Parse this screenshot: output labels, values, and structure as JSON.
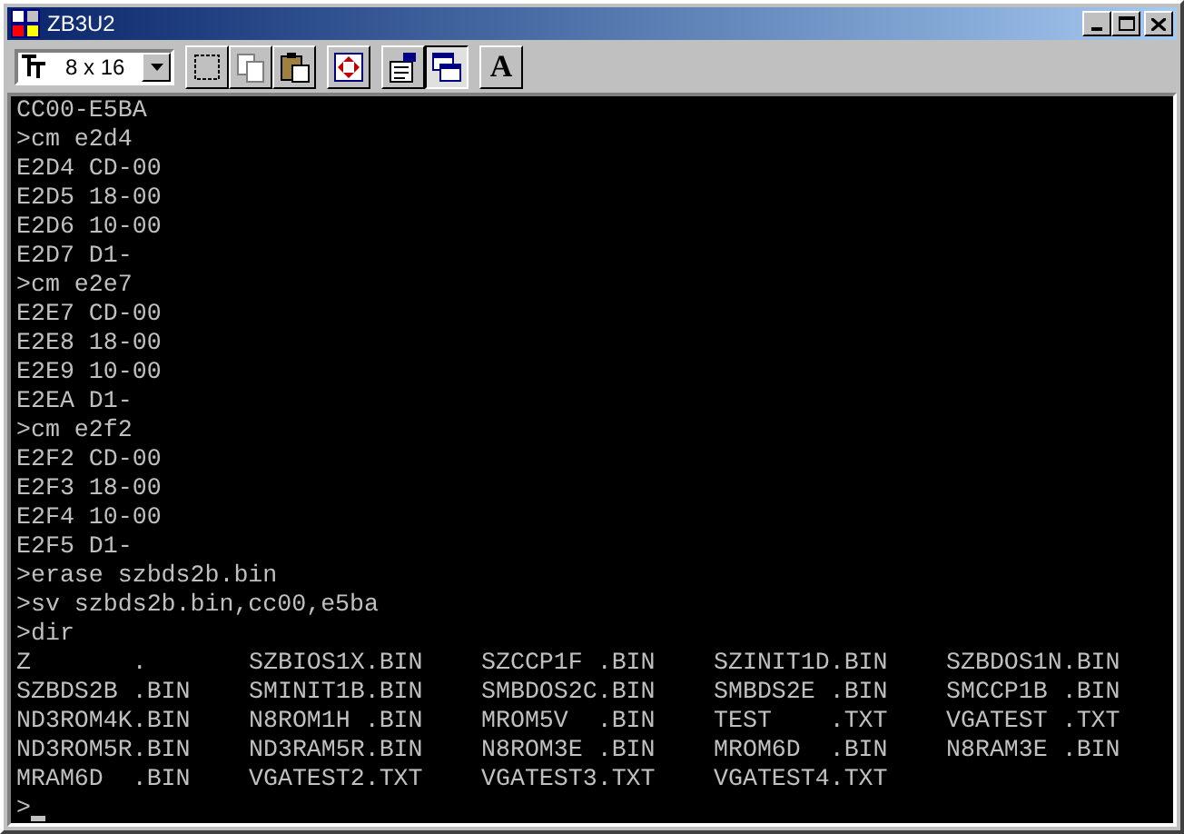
{
  "window": {
    "title": "ZB3U2"
  },
  "toolbar": {
    "font_size": "8 x 16",
    "buttons": [
      {
        "kind": "mark",
        "pressed": false
      },
      {
        "kind": "copy",
        "pressed": false
      },
      {
        "kind": "paste",
        "pressed": false
      },
      {
        "kind": "fullscreen",
        "pressed": false
      },
      {
        "kind": "properties",
        "pressed": false
      },
      {
        "kind": "background",
        "pressed": true
      },
      {
        "kind": "font",
        "pressed": false,
        "label": "A"
      }
    ]
  },
  "console": {
    "lines": [
      {
        "kind": "text",
        "text": "CC00-E5BA"
      },
      {
        "kind": "text",
        "text": ">cm e2d4"
      },
      {
        "kind": "text",
        "text": "E2D4 CD-00"
      },
      {
        "kind": "text",
        "text": "E2D5 18-00"
      },
      {
        "kind": "text",
        "text": "E2D6 10-00"
      },
      {
        "kind": "text",
        "text": "E2D7 D1-"
      },
      {
        "kind": "text",
        "text": ">cm e2e7"
      },
      {
        "kind": "text",
        "text": "E2E7 CD-00"
      },
      {
        "kind": "text",
        "text": "E2E8 18-00"
      },
      {
        "kind": "text",
        "text": "E2E9 10-00"
      },
      {
        "kind": "text",
        "text": "E2EA D1-"
      },
      {
        "kind": "text",
        "text": ">cm e2f2"
      },
      {
        "kind": "text",
        "text": "E2F2 CD-00"
      },
      {
        "kind": "text",
        "text": "E2F3 18-00"
      },
      {
        "kind": "text",
        "text": "E2F4 10-00"
      },
      {
        "kind": "text",
        "text": "E2F5 D1-"
      },
      {
        "kind": "text",
        "text": ">erase szbds2b.bin"
      },
      {
        "kind": "text",
        "text": ">sv szbds2b.bin,cc00,e5ba"
      },
      {
        "kind": "text",
        "text": ">dir"
      },
      {
        "kind": "dir",
        "entries": [
          "Z       .   ",
          "SZBIOS1X.BIN",
          "SZCCP1F .BIN",
          "SZINIT1D.BIN",
          "SZBDOS1N.BIN"
        ]
      },
      {
        "kind": "dir",
        "entries": [
          "SZBDS2B .BIN",
          "SMINIT1B.BIN",
          "SMBDOS2C.BIN",
          "SMBDS2E .BIN",
          "SMCCP1B .BIN"
        ]
      },
      {
        "kind": "dir",
        "entries": [
          "ND3ROM4K.BIN",
          "N8ROM1H .BIN",
          "MROM5V  .BIN",
          "TEST    .TXT",
          "VGATEST .TXT"
        ]
      },
      {
        "kind": "dir",
        "entries": [
          "ND3ROM5R.BIN",
          "ND3RAM5R.BIN",
          "N8ROM3E .BIN",
          "MROM6D  .BIN",
          "N8RAM3E .BIN"
        ]
      },
      {
        "kind": "dir",
        "entries": [
          "MRAM6D  .BIN",
          "VGATEST2.TXT",
          "VGATEST3.TXT",
          "VGATEST4.TXT"
        ]
      },
      {
        "kind": "prompt",
        "text": ">",
        "cursor": true
      }
    ]
  }
}
